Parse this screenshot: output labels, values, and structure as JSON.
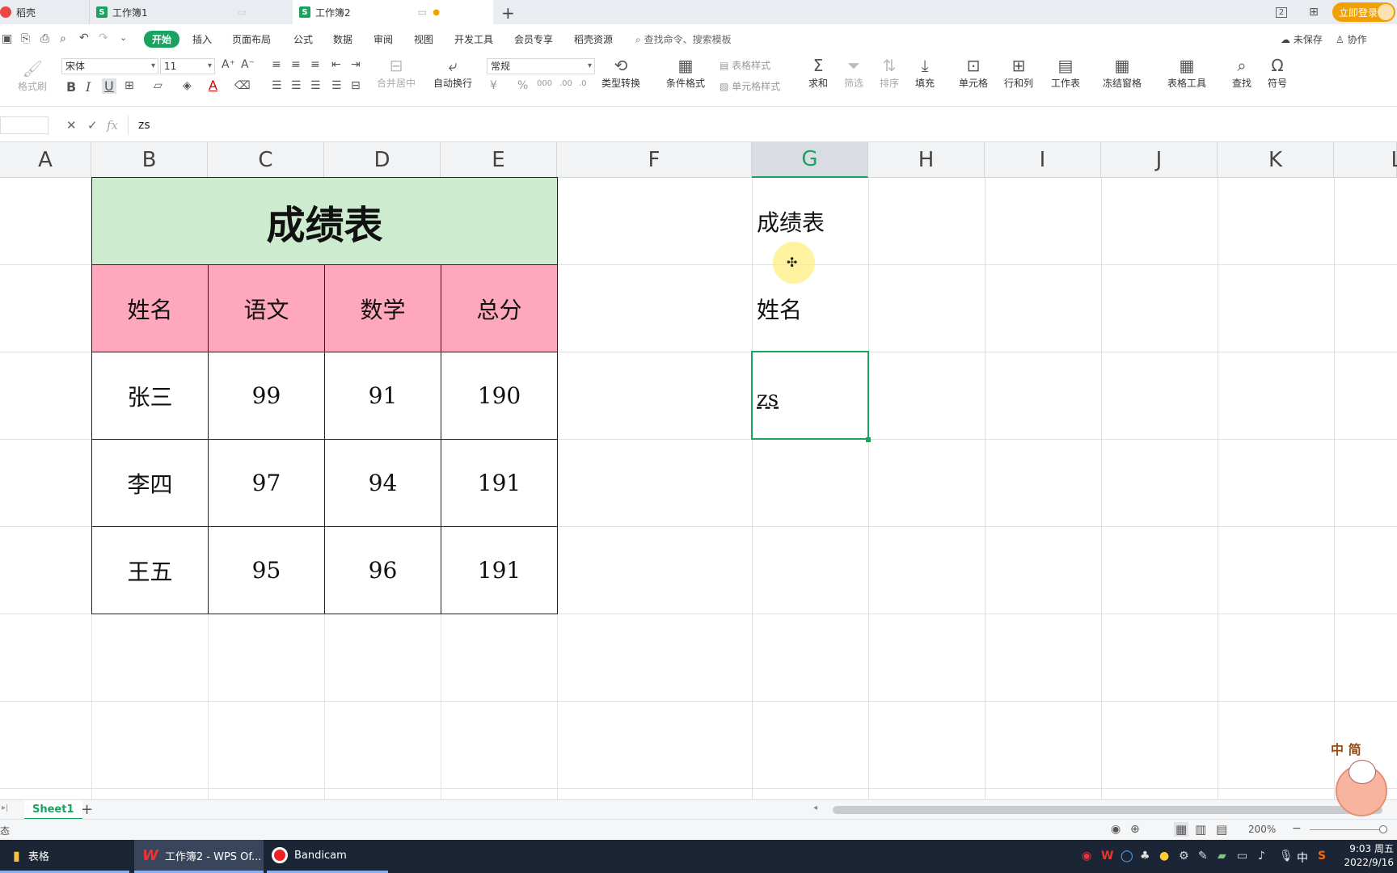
{
  "titlebar": {
    "tabs": [
      {
        "label": "稻壳",
        "active": false
      },
      {
        "label": "工作簿1",
        "active": false
      },
      {
        "label": "工作簿2",
        "active": true
      }
    ],
    "login_label": "立即登录",
    "page_count": "2"
  },
  "menubar": {
    "items": [
      "开始",
      "插入",
      "页面布局",
      "公式",
      "数据",
      "审阅",
      "视图",
      "开发工具",
      "会员专享",
      "稻壳资源"
    ],
    "search_placeholder": "查找命令、搜索模板",
    "unsaved_label": "未保存",
    "collab_label": "协作"
  },
  "ribbon": {
    "format_painter": "格式刷",
    "font_name": "宋体",
    "font_size": "11",
    "merge_center": "合并居中",
    "auto_wrap": "自动换行",
    "number_format": "常规",
    "type_convert": "类型转换",
    "cond_format": "条件格式",
    "table_style": "表格样式",
    "cell_style": "单元格样式",
    "sum": "求和",
    "filter": "筛选",
    "sort": "排序",
    "fill": "填充",
    "cell": "单元格",
    "row_col": "行和列",
    "worksheet": "工作表",
    "freeze": "冻结窗格",
    "table_tools": "表格工具",
    "find": "查找",
    "symbol": "符号"
  },
  "formula": {
    "content": "zs",
    "fx_label": "fx"
  },
  "columns": [
    "A",
    "B",
    "C",
    "D",
    "E",
    "F",
    "G",
    "H",
    "I",
    "J",
    "K",
    "L"
  ],
  "selected_column": "G",
  "table": {
    "title": "成绩表",
    "headers": [
      "姓名",
      "语文",
      "数学",
      "总分"
    ],
    "rows": [
      [
        "张三",
        "99",
        "91",
        "190"
      ],
      [
        "李四",
        "97",
        "94",
        "191"
      ],
      [
        "王五",
        "95",
        "96",
        "191"
      ]
    ]
  },
  "g_column": {
    "g1": "成绩表",
    "g2": "姓名",
    "g3": "zs"
  },
  "sheets": {
    "active": "Sheet1"
  },
  "statusbar": {
    "left_text": "态",
    "zoom": "200%"
  },
  "taskbar": {
    "items": [
      {
        "label": "表格"
      },
      {
        "label": "工作簿2 - WPS Of..."
      },
      {
        "label": "Bandicam"
      }
    ],
    "ime": "中",
    "time": "9:03 周五",
    "date": "2022/9/16"
  },
  "sticker": {
    "text": "中 简"
  }
}
